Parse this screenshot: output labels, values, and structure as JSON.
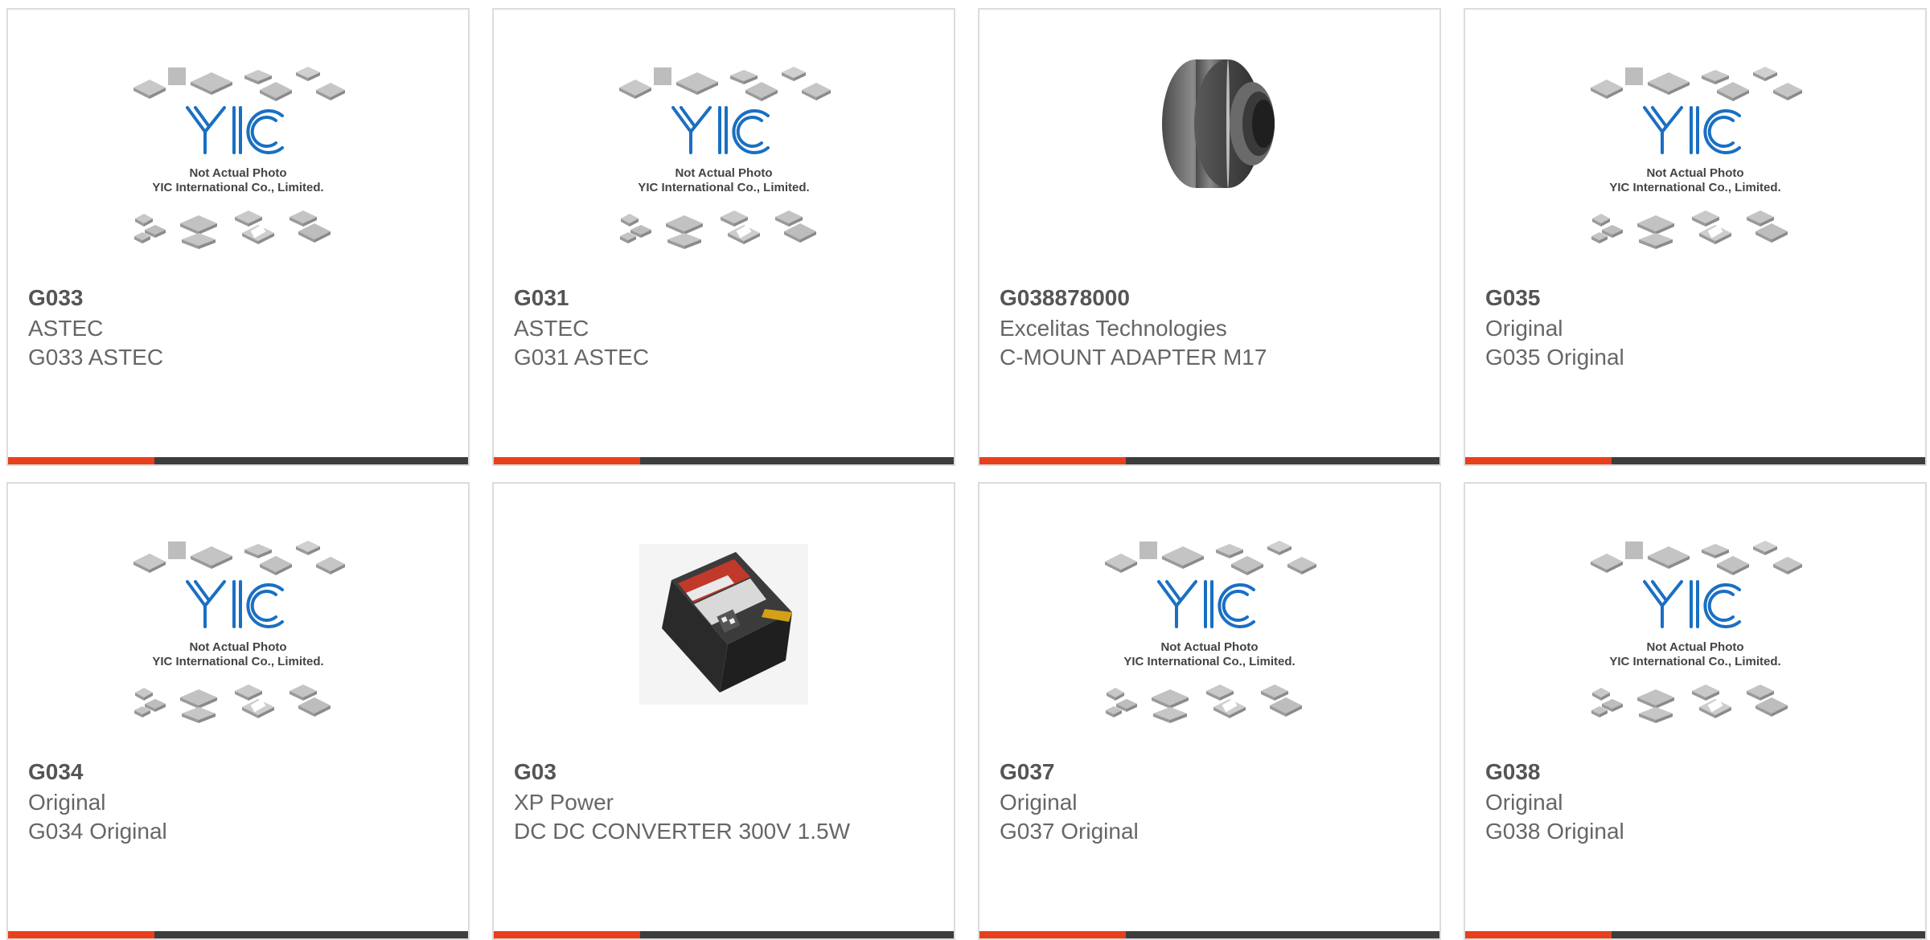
{
  "colors": {
    "accent": "#e8401c",
    "bar_dark": "#3d3d3d",
    "card_border": "#dcdcdc"
  },
  "products": [
    {
      "part_number": "G033",
      "manufacturer": "ASTEC",
      "description": "G033 ASTEC",
      "image": "yic-placeholder",
      "placeholder_line1": "Not Actual Photo",
      "placeholder_line2": "YIC International Co., Limited."
    },
    {
      "part_number": "G031",
      "manufacturer": "ASTEC",
      "description": "G031 ASTEC",
      "image": "yic-placeholder",
      "placeholder_line1": "Not Actual Photo",
      "placeholder_line2": "YIC International Co., Limited."
    },
    {
      "part_number": "G038878000",
      "manufacturer": "Excelitas Technologies",
      "description": "C-MOUNT ADAPTER M17",
      "image": "c-mount-adapter"
    },
    {
      "part_number": "G035",
      "manufacturer": "Original",
      "description": "G035 Original",
      "image": "yic-placeholder",
      "placeholder_line1": "Not Actual Photo",
      "placeholder_line2": "YIC International Co., Limited."
    },
    {
      "part_number": "G034",
      "manufacturer": "Original",
      "description": "G034 Original",
      "image": "yic-placeholder",
      "placeholder_line1": "Not Actual Photo",
      "placeholder_line2": "YIC International Co., Limited."
    },
    {
      "part_number": "G03",
      "manufacturer": "XP Power",
      "description": "DC DC CONVERTER 300V 1.5W",
      "image": "dc-dc-converter"
    },
    {
      "part_number": "G037",
      "manufacturer": "Original",
      "description": "G037 Original",
      "image": "yic-placeholder",
      "placeholder_line1": "Not Actual Photo",
      "placeholder_line2": "YIC International Co., Limited."
    },
    {
      "part_number": "G038",
      "manufacturer": "Original",
      "description": "G038 Original",
      "image": "yic-placeholder",
      "placeholder_line1": "Not Actual Photo",
      "placeholder_line2": "YIC International Co., Limited."
    }
  ]
}
